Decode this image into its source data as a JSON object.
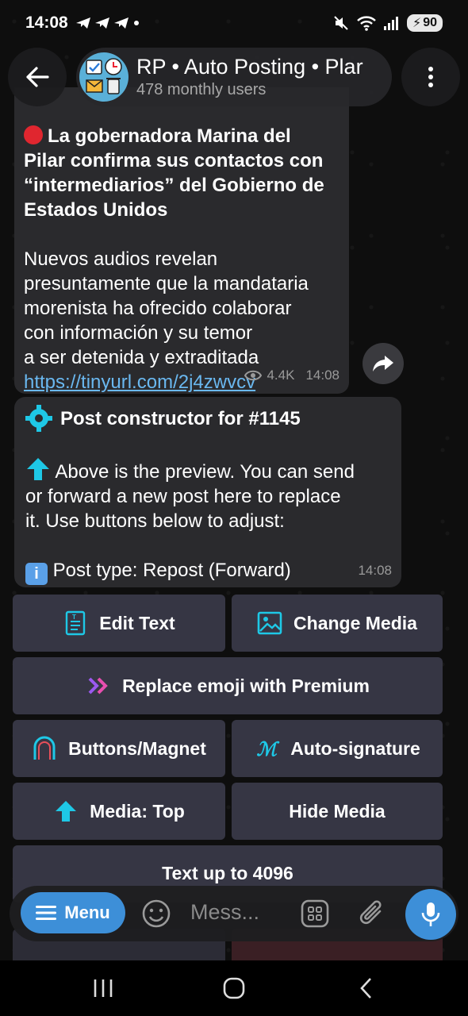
{
  "status_bar": {
    "time": "14:08",
    "battery": "90"
  },
  "header": {
    "title": "RP • Auto Posting • Plar",
    "subtitle": "478 monthly users"
  },
  "message1": {
    "headline_lines": [
      "La gobernadora Marina del",
      "Pilar confirma sus contactos con",
      "“intermediarios” del Gobierno de",
      "Estados Unidos"
    ],
    "body_lines": [
      "Nuevos audios revelan",
      "presuntamente que la mandataria",
      "morenista ha ofrecido colaborar",
      "con información y su temor",
      "a ser detenida y extraditada"
    ],
    "link": "https://tinyurl.com/2j4zwvcv",
    "views": "4.4K",
    "time": "14:08"
  },
  "message2": {
    "title": "Post constructor for #1145",
    "body_lines": [
      "Above is the preview. You can send",
      "or forward a new post here to replace",
      "it. Use buttons below to adjust:"
    ],
    "post_type": "Post type: Repost (Forward)",
    "time": "14:08"
  },
  "keyboard": {
    "edit_text": "Edit Text",
    "change_media": "Change Media",
    "replace_emoji": "Replace emoji with Premium",
    "buttons_magnet": "Buttons/Magnet",
    "auto_signature": "Auto-signature",
    "media_top": "Media: Top",
    "hide_media": "Hide Media",
    "text_limit": "Text up to 4096"
  },
  "input_bar": {
    "menu_label": "Menu",
    "placeholder": "Mess..."
  },
  "colors": {
    "accent": "#3d8fd8",
    "bubble": "#2a2a2d",
    "button": "#363644",
    "icon_cyan": "#1ec8e6",
    "link": "#6ab8f0"
  }
}
